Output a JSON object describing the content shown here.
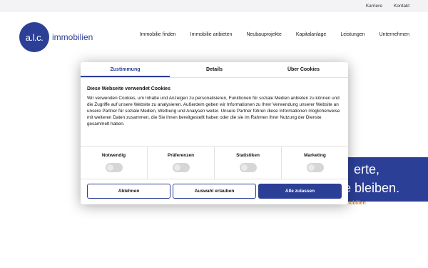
{
  "topbar": {
    "links": [
      "Karriere",
      "Kontakt"
    ]
  },
  "logo": {
    "mark": "a.l.c.",
    "text": "immobilien"
  },
  "nav": [
    "Immobilie finden",
    "Immobilie anbieten",
    "Neubauprojekte",
    "Kapitalanlage",
    "Leistungen",
    "Unternehmen"
  ],
  "hero": {
    "line1": "erte,",
    "line2": "e bleiben.",
    "sub": "mobilien"
  },
  "dialog": {
    "tabs": [
      "Zustimmung",
      "Details",
      "Über Cookies"
    ],
    "title": "Diese Webseite verwendet Cookies",
    "text": "Wir verwenden Cookies, um Inhalte und Anzeigen zu personalisieren, Funktionen für soziale Medien anbieten zu können und die Zugriffe auf unsere Website zu analysieren. Außerdem geben wir Informationen zu Ihrer Verwendung unserer Website an unsere Partner für soziale Medien, Werbung und Analysen weiter. Unsere Partner führen diese Informationen möglicherweise mit weiteren Daten zusammen, die Sie ihnen bereitgestellt haben oder die sie im Rahmen Ihrer Nutzung der Dienste gesammelt haben.",
    "toggles": [
      "Notwendig",
      "Präferenzen",
      "Statistiken",
      "Marketing"
    ],
    "buttons": {
      "reject": "Ablehnen",
      "selection": "Auswahl erlauben",
      "accept": "Alle zulassen"
    }
  },
  "colors": {
    "brand": "#2c3f96",
    "accent": "#c8902e"
  }
}
